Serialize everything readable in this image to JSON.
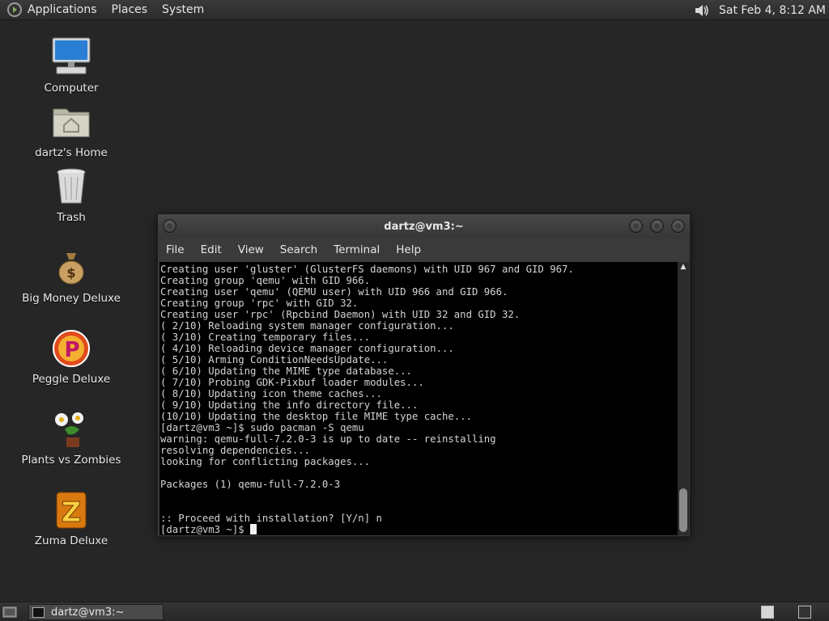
{
  "top_panel": {
    "menus": [
      "Applications",
      "Places",
      "System"
    ],
    "clock": "Sat Feb  4,  8:12 AM",
    "volume_icon": "speaker-icon"
  },
  "desktop_icons": [
    {
      "label": "Computer",
      "icon": "computer-icon"
    },
    {
      "label": "dartz's Home",
      "icon": "home-folder-icon"
    },
    {
      "label": "Trash",
      "icon": "trash-icon"
    },
    {
      "label": "Big Money Deluxe",
      "icon": "money-bag-icon"
    },
    {
      "label": "Peggle Deluxe",
      "icon": "peggle-icon"
    },
    {
      "label": "Plants vs Zombies",
      "icon": "plants-icon"
    },
    {
      "label": "Zuma Deluxe",
      "icon": "zuma-icon"
    }
  ],
  "terminal": {
    "title": "dartz@vm3:~",
    "menu": [
      "File",
      "Edit",
      "View",
      "Search",
      "Terminal",
      "Help"
    ],
    "lines": [
      "Creating user 'gluster' (GlusterFS daemons) with UID 967 and GID 967.",
      "Creating group 'qemu' with GID 966.",
      "Creating user 'qemu' (QEMU user) with UID 966 and GID 966.",
      "Creating group 'rpc' with GID 32.",
      "Creating user 'rpc' (Rpcbind Daemon) with UID 32 and GID 32.",
      "( 2/10) Reloading system manager configuration...",
      "( 3/10) Creating temporary files...",
      "( 4/10) Reloading device manager configuration...",
      "( 5/10) Arming ConditionNeedsUpdate...",
      "( 6/10) Updating the MIME type database...",
      "( 7/10) Probing GDK-Pixbuf loader modules...",
      "( 8/10) Updating icon theme caches...",
      "( 9/10) Updating the info directory file...",
      "(10/10) Updating the desktop file MIME type cache...",
      "[dartz@vm3 ~]$ sudo pacman -S qemu",
      "warning: qemu-full-7.2.0-3 is up to date -- reinstalling",
      "resolving dependencies...",
      "looking for conflicting packages...",
      "",
      "Packages (1) qemu-full-7.2.0-3",
      "",
      "",
      ":: Proceed with installation? [Y/n] n"
    ],
    "prompt": "[dartz@vm3 ~]$ "
  },
  "taskbar": {
    "window_label": "dartz@vm3:~"
  }
}
